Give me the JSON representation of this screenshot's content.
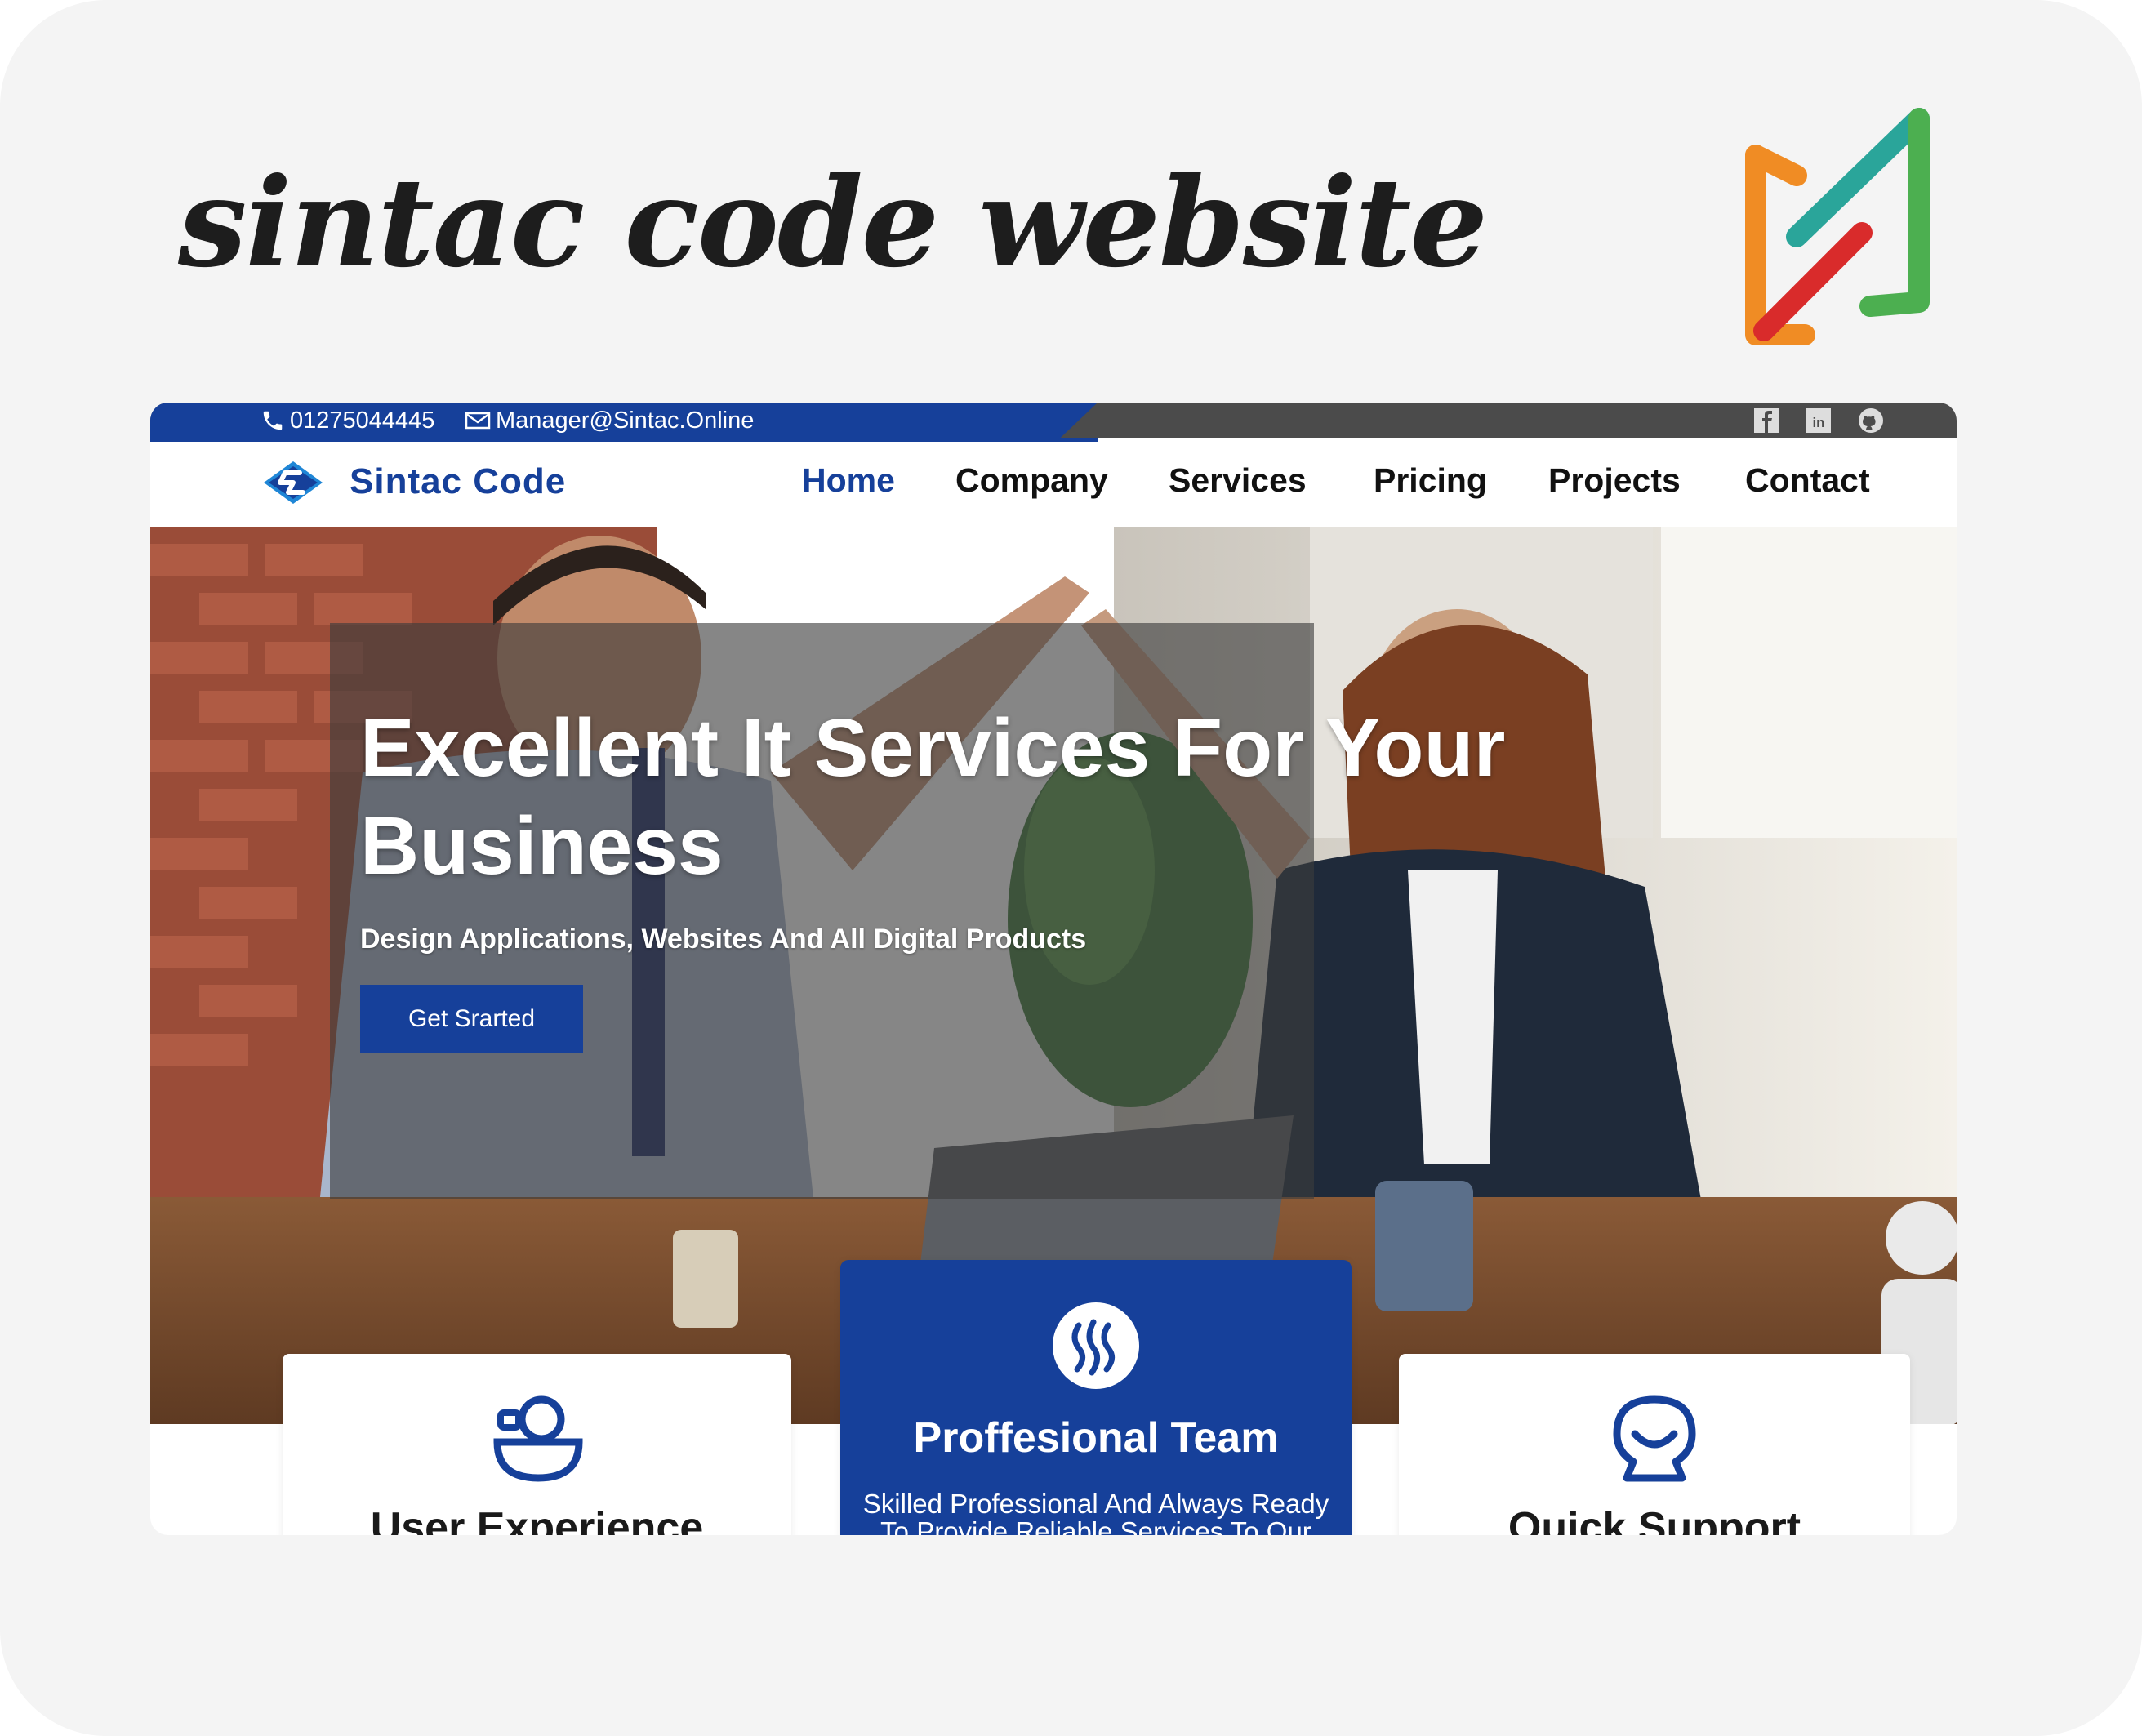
{
  "showcase": {
    "title": "sintac code website"
  },
  "topbar": {
    "phone": "01275044445",
    "email": "Manager@Sintac.Online",
    "social_icons": [
      "facebook-icon",
      "linkedin-icon",
      "github-icon"
    ]
  },
  "navbar": {
    "logo_text": "Sintac Code",
    "items": [
      {
        "label": "Home",
        "active": true
      },
      {
        "label": "Company",
        "active": false
      },
      {
        "label": "Services",
        "active": false
      },
      {
        "label": "Pricing",
        "active": false
      },
      {
        "label": "Projects",
        "active": false
      },
      {
        "label": "Contact",
        "active": false
      }
    ]
  },
  "hero": {
    "title": "Excellent It Services For Your Business",
    "subtitle": "Design Applications, Websites And All Digital Products",
    "cta_label": "Get Srarted"
  },
  "features": [
    {
      "title": "User Experience",
      "icon": "user-experience-icon"
    },
    {
      "title": "Proffesional Team",
      "icon": "steem-icon",
      "text": "Skilled Professional And Always Ready To Provide Reliable Services To Our"
    },
    {
      "title": "Quick Support",
      "icon": "support-icon"
    }
  ],
  "colors": {
    "brand_blue": "#16409a",
    "topbar_gray": "#4b4b4b",
    "page_bg": "#f4f4f4"
  }
}
